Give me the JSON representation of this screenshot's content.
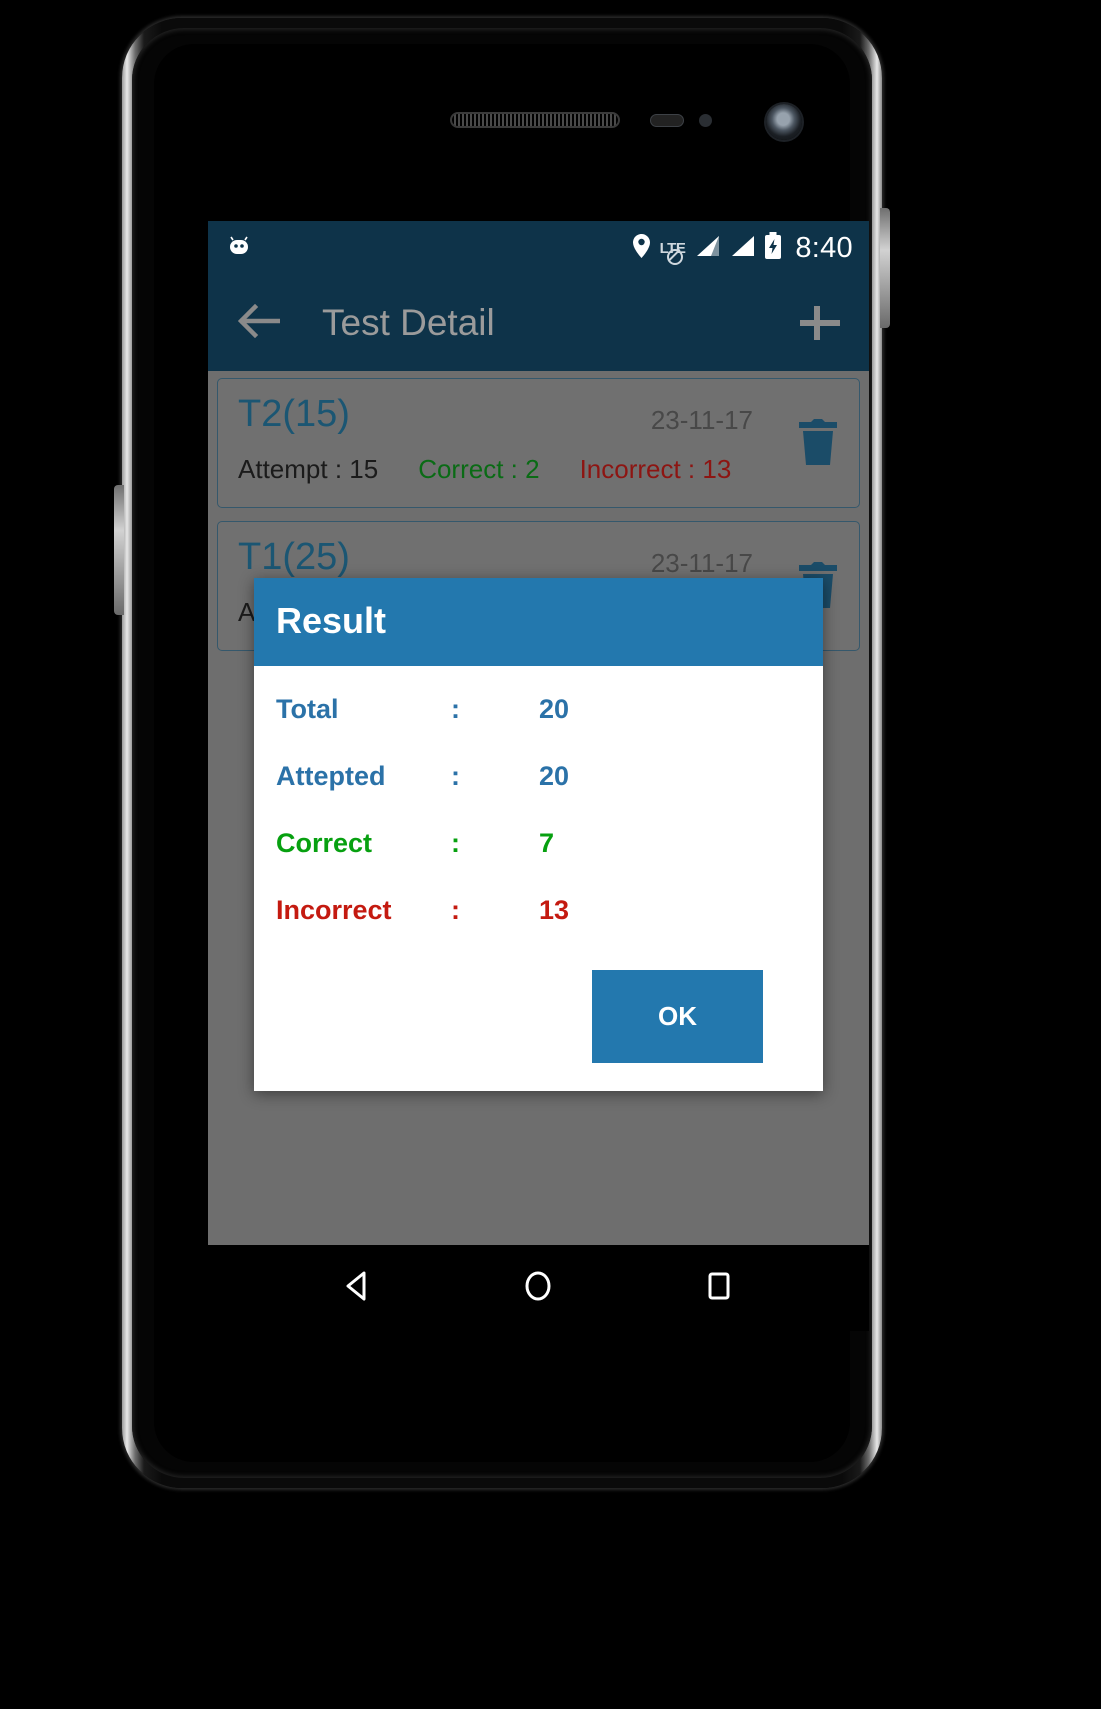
{
  "status_bar": {
    "time": "8:40",
    "icons": {
      "app_notification": "android-robot-icon",
      "location": "location-pin-icon",
      "network_type": "LTE",
      "signal_1": "signal-bar-icon",
      "signal_2": "signal-bar-icon",
      "battery": "battery-charging-icon"
    }
  },
  "app_bar": {
    "back_label": "back-arrow",
    "title": "Test Detail",
    "add_label": "add"
  },
  "colors": {
    "app_bar_bg": "#0e3349",
    "dialog_accent": "#2378ae",
    "correct_green": "#07a010",
    "incorrect_red": "#c41a10",
    "label_blue": "#2b72a8",
    "card_title_blue": "#1b5673",
    "screen_bg": "#6e6e6e"
  },
  "test_list": [
    {
      "name": "T2(15)",
      "date": "23-11-17",
      "attempt": "Attempt : 15",
      "correct": "Correct : 2",
      "incorrect": "Incorrect : 13",
      "delete_icon": "trash-icon"
    },
    {
      "name": "T1(25)",
      "date": "23-11-17",
      "attempt": "At",
      "correct": "",
      "incorrect": "",
      "delete_icon": "trash-icon"
    }
  ],
  "dialog": {
    "title": "Result",
    "rows": [
      {
        "label": "Total",
        "colon": ":",
        "value": "20"
      },
      {
        "label": "Attepted",
        "colon": ":",
        "value": "20"
      },
      {
        "label": "Correct",
        "colon": ":",
        "value": "7"
      },
      {
        "label": "Incorrect",
        "colon": ":",
        "value": "13"
      }
    ],
    "ok_label": "OK"
  },
  "nav_bar": {
    "back": "back-triangle-icon",
    "home": "home-circle-icon",
    "recents": "recents-square-icon"
  }
}
